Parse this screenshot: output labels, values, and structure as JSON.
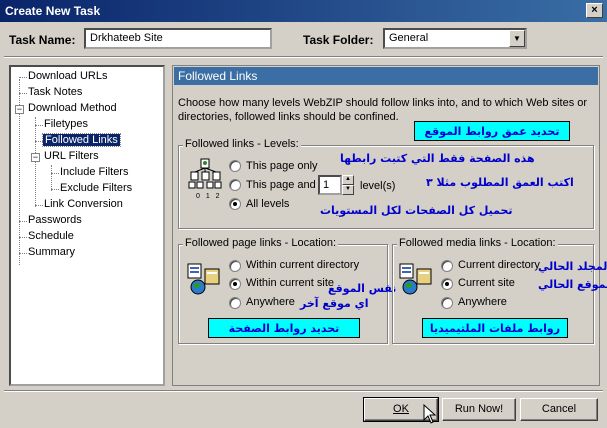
{
  "window": {
    "title": "Create New Task",
    "close_glyph": "×"
  },
  "task_name": {
    "label": "Task Name:",
    "value": "Drkhateeb Site"
  },
  "task_folder": {
    "label": "Task Folder:",
    "value": "General",
    "arrow": "▼"
  },
  "tree": {
    "items": [
      {
        "label": "Download URLs"
      },
      {
        "label": "Task Notes"
      },
      {
        "label": "Download Method"
      },
      {
        "label": "Filetypes"
      },
      {
        "label": "Followed Links"
      },
      {
        "label": "URL Filters"
      },
      {
        "label": "Include Filters"
      },
      {
        "label": "Exclude Filters"
      },
      {
        "label": "Link Conversion"
      },
      {
        "label": "Passwords"
      },
      {
        "label": "Schedule"
      },
      {
        "label": "Summary"
      }
    ],
    "minus_glyph": "−"
  },
  "panel": {
    "header": "Followed Links",
    "description": "Choose how many levels WebZIP should follow links into, and to which Web sites or directories, followed links should be confined."
  },
  "levels": {
    "title": "Followed links - Levels:",
    "options": [
      "This page only",
      "This page and",
      "All levels"
    ],
    "spin_value": "1",
    "spin_suffix": "level(s)",
    "spin_up": "▲",
    "spin_down": "▼",
    "icon_digits": "0 1 2"
  },
  "page_location": {
    "title": "Followed page links - Location:",
    "options": [
      "Within current directory",
      "Within current site",
      "Anywhere"
    ]
  },
  "media_location": {
    "title": "Followed media links - Location:",
    "options": [
      "Current directory",
      "Current site",
      "Anywhere"
    ]
  },
  "annotations": {
    "banner_depth": "تحديد عمق روابط الموقع",
    "this_page_only": "هذه الصفحة فقط التي كتبت رابطها",
    "depth_example": "اكتب العمق المطلوب مثلا ٣",
    "all_pages": "تحميل كل الصفحات لكل المستويات",
    "same_site": "نفس الموقع",
    "other_site": "اي موقع آخر",
    "banner_page_links": "تحديد روابط الصفحة",
    "current_folder": "المجلد الحالي",
    "current_site": "الموقع الحالي",
    "banner_media": "روابط ملفات الملتيميديا"
  },
  "buttons": {
    "ok": "OK",
    "run_now": "Run Now!",
    "cancel": "Cancel"
  },
  "colors": {
    "title_bar": "#0a246a",
    "panel_header": "#3a6ea5",
    "annotation_text": "#0000cc",
    "banner_bg": "#00ffff"
  }
}
